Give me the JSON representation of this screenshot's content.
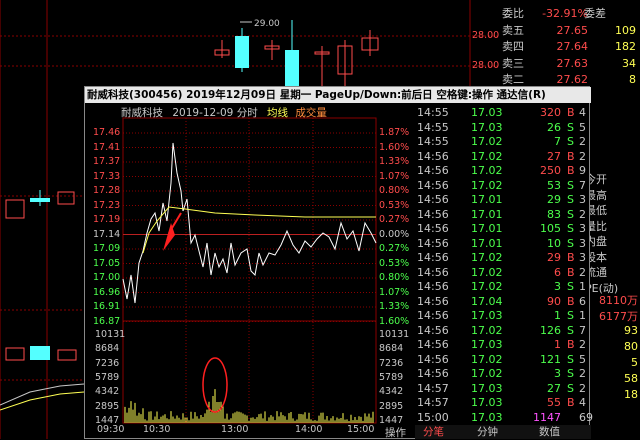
{
  "background_chart": {
    "price_labels": [
      "28.00",
      "28.00"
    ],
    "top_marker": "29.00"
  },
  "order_book": [
    {
      "label": "委比",
      "value": "-32.91%",
      "extra": "委差",
      "value_color": "#ff4c4c"
    },
    {
      "label": "卖五",
      "value": "27.65",
      "extra": "109",
      "value_color": "#ff4c4c"
    },
    {
      "label": "卖四",
      "value": "27.64",
      "extra": "182",
      "value_color": "#ff4c4c"
    },
    {
      "label": "卖三",
      "value": "27.63",
      "extra": "34",
      "value_color": "#ff4c4c"
    },
    {
      "label": "卖二",
      "value": "27.62",
      "extra": "8",
      "value_color": "#ff4c4c"
    }
  ],
  "right_labels": [
    "今开",
    "最高",
    "最低",
    "量比",
    "内盘",
    "股本",
    "流通",
    "PE(动)"
  ],
  "right_numbers": [
    {
      "text": "8110万",
      "color": "#ff4c4c"
    },
    {
      "text": "6177万",
      "color": "#ff4c4c"
    },
    {
      "text": "93",
      "color": "#ffff54"
    },
    {
      "text": "80",
      "color": "#ffff54"
    },
    {
      "text": "5",
      "color": "#ffff54"
    },
    {
      "text": "58",
      "color": "#ffff54"
    },
    {
      "text": "18",
      "color": "#ffff54"
    }
  ],
  "popup": {
    "title": "耐威科技(300456)  2019年12月09日 星期一  PageUp/Down:前后日 空格键:操作 通达信(R)",
    "stock_name": "耐威科技",
    "date": "2019-12-09 分时",
    "avg_label": "均线",
    "vol_label": "成交量",
    "price_ticks": [
      "17.46",
      "17.41",
      "17.37",
      "17.33",
      "17.28",
      "17.23",
      "17.19",
      "17.14",
      "17.09",
      "17.05",
      "17.00",
      "16.96",
      "16.91",
      "16.87"
    ],
    "pct_ticks": [
      "1.87%",
      "1.60%",
      "1.33%",
      "1.07%",
      "0.80%",
      "0.53%",
      "0.27%",
      "0.00%",
      "0.27%",
      "0.53%",
      "0.80%",
      "1.07%",
      "1.33%",
      "1.60%"
    ],
    "volume_ticks": [
      "10131",
      "8684",
      "7236",
      "5789",
      "4342",
      "2895",
      "1447"
    ],
    "time_ticks": [
      "09:30",
      "10:30",
      "13:00",
      "14:00",
      "15:00"
    ],
    "ops_label": "操作",
    "tabs": [
      "分笔",
      "分钟",
      "数值"
    ]
  },
  "trades": [
    {
      "time": "14:55",
      "price": "17.03",
      "vol": "320",
      "flag": "B",
      "extra": "4"
    },
    {
      "time": "14:55",
      "price": "17.03",
      "vol": "26",
      "flag": "S",
      "extra": "5"
    },
    {
      "time": "14:55",
      "price": "17.02",
      "vol": "7",
      "flag": "S",
      "extra": "2"
    },
    {
      "time": "14:56",
      "price": "17.02",
      "vol": "27",
      "flag": "B",
      "extra": "2"
    },
    {
      "time": "14:56",
      "price": "17.02",
      "vol": "250",
      "flag": "B",
      "extra": "9"
    },
    {
      "time": "14:56",
      "price": "17.02",
      "vol": "53",
      "flag": "S",
      "extra": "7"
    },
    {
      "time": "14:56",
      "price": "17.01",
      "vol": "29",
      "flag": "S",
      "extra": "3"
    },
    {
      "time": "14:56",
      "price": "17.01",
      "vol": "83",
      "flag": "S",
      "extra": "2"
    },
    {
      "time": "14:56",
      "price": "17.01",
      "vol": "105",
      "flag": "S",
      "extra": "3"
    },
    {
      "time": "14:56",
      "price": "17.01",
      "vol": "10",
      "flag": "S",
      "extra": "3"
    },
    {
      "time": "14:56",
      "price": "17.02",
      "vol": "29",
      "flag": "B",
      "extra": "3"
    },
    {
      "time": "14:56",
      "price": "17.02",
      "vol": "6",
      "flag": "B",
      "extra": "2"
    },
    {
      "time": "14:56",
      "price": "17.02",
      "vol": "3",
      "flag": "S",
      "extra": "1"
    },
    {
      "time": "14:56",
      "price": "17.04",
      "vol": "90",
      "flag": "B",
      "extra": "6"
    },
    {
      "time": "14:56",
      "price": "17.03",
      "vol": "1",
      "flag": "S",
      "extra": "1"
    },
    {
      "time": "14:56",
      "price": "17.02",
      "vol": "126",
      "flag": "S",
      "extra": "7"
    },
    {
      "time": "14:56",
      "price": "17.03",
      "vol": "1",
      "flag": "B",
      "extra": "2"
    },
    {
      "time": "14:56",
      "price": "17.02",
      "vol": "121",
      "flag": "S",
      "extra": "5"
    },
    {
      "time": "14:56",
      "price": "17.02",
      "vol": "3",
      "flag": "S",
      "extra": "2"
    },
    {
      "time": "14:57",
      "price": "17.03",
      "vol": "27",
      "flag": "S",
      "extra": "2"
    },
    {
      "time": "14:57",
      "price": "17.03",
      "vol": "55",
      "flag": "B",
      "extra": "4"
    },
    {
      "time": "15:00",
      "price": "17.03",
      "vol": "1147",
      "flag": "",
      "extra": "69"
    }
  ],
  "colors": {
    "up": "#ff4c4c",
    "down": "#4cff4c",
    "yellow": "#ffff54",
    "grid": "#8a0000",
    "avg": "#ffff54",
    "price": "#ffffff",
    "highlight": "#ff2020"
  }
}
